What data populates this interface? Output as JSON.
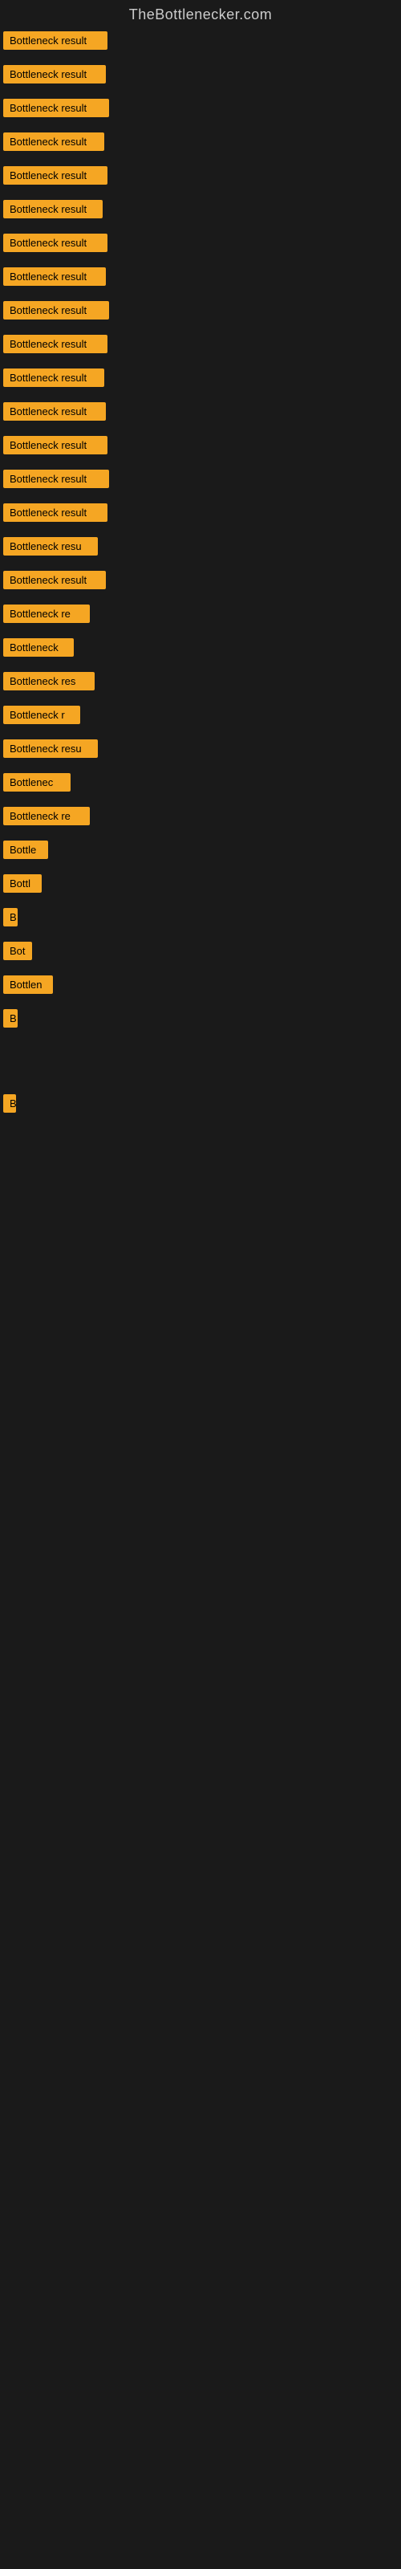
{
  "site_title": "TheBottlenecker.com",
  "bars": [
    {
      "label": "Bottleneck result",
      "width": 130
    },
    {
      "label": "Bottleneck result",
      "width": 128
    },
    {
      "label": "Bottleneck result",
      "width": 132
    },
    {
      "label": "Bottleneck result",
      "width": 126
    },
    {
      "label": "Bottleneck result",
      "width": 130
    },
    {
      "label": "Bottleneck result",
      "width": 124
    },
    {
      "label": "Bottleneck result",
      "width": 130
    },
    {
      "label": "Bottleneck result",
      "width": 128
    },
    {
      "label": "Bottleneck result",
      "width": 132
    },
    {
      "label": "Bottleneck result",
      "width": 130
    },
    {
      "label": "Bottleneck result",
      "width": 126
    },
    {
      "label": "Bottleneck result",
      "width": 128
    },
    {
      "label": "Bottleneck result",
      "width": 130
    },
    {
      "label": "Bottleneck result",
      "width": 132
    },
    {
      "label": "Bottleneck result",
      "width": 130
    },
    {
      "label": "Bottleneck resu",
      "width": 118
    },
    {
      "label": "Bottleneck result",
      "width": 128
    },
    {
      "label": "Bottleneck re",
      "width": 108
    },
    {
      "label": "Bottleneck",
      "width": 88
    },
    {
      "label": "Bottleneck res",
      "width": 114
    },
    {
      "label": "Bottleneck r",
      "width": 96
    },
    {
      "label": "Bottleneck resu",
      "width": 118
    },
    {
      "label": "Bottlenec",
      "width": 84
    },
    {
      "label": "Bottleneck re",
      "width": 108
    },
    {
      "label": "Bottle",
      "width": 56
    },
    {
      "label": "Bottl",
      "width": 48
    },
    {
      "label": "B",
      "width": 18
    },
    {
      "label": "Bot",
      "width": 36
    },
    {
      "label": "Bottlen",
      "width": 62
    },
    {
      "label": "B",
      "width": 18
    },
    {
      "label": "",
      "width": 0
    },
    {
      "label": "",
      "width": 0
    },
    {
      "label": "B",
      "width": 14
    },
    {
      "label": "",
      "width": 0
    },
    {
      "label": "",
      "width": 0
    },
    {
      "label": "",
      "width": 0
    },
    {
      "label": "",
      "width": 0
    }
  ]
}
